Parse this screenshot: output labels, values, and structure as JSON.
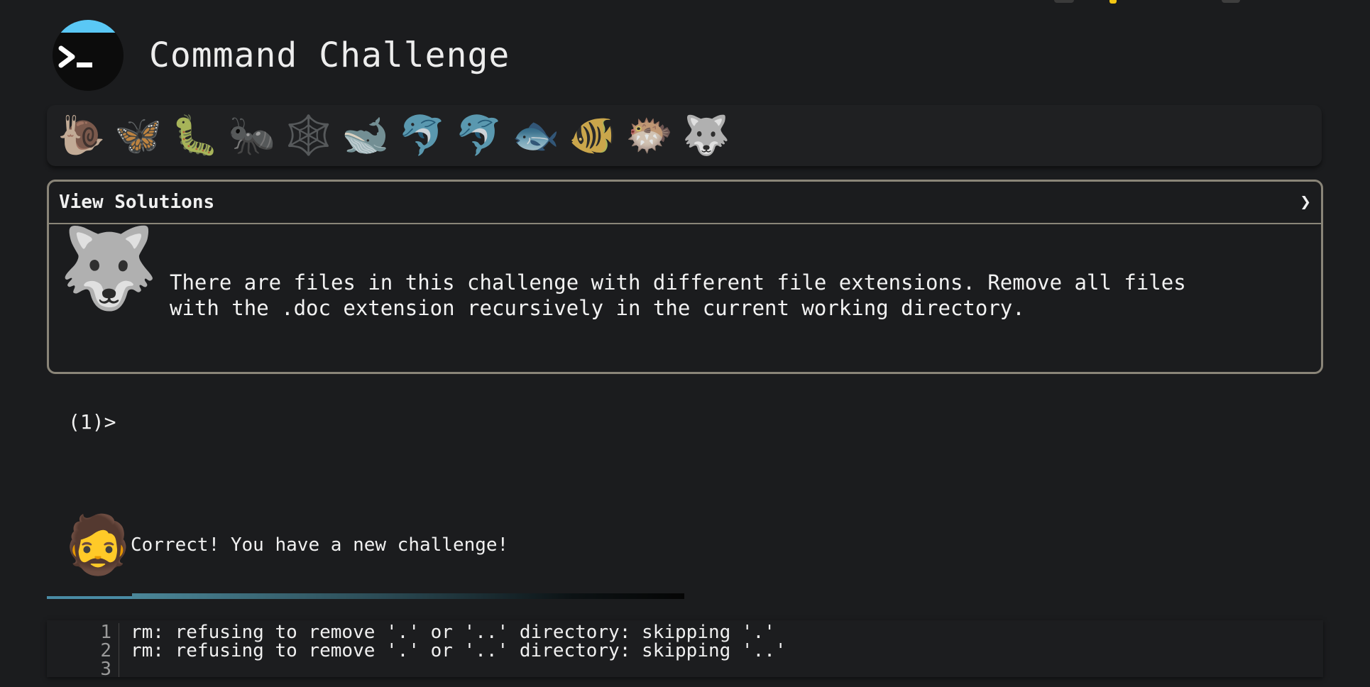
{
  "app": {
    "title": "Command Challenge"
  },
  "levels": [
    {
      "emoji": "🐌",
      "icon": "snail-icon"
    },
    {
      "emoji": "🦋",
      "icon": "butterfly-icon"
    },
    {
      "emoji": "🐛",
      "icon": "caterpillar-icon"
    },
    {
      "emoji": "🐜",
      "icon": "ant-icon"
    },
    {
      "emoji": "🕸️",
      "icon": "spider-web-icon"
    },
    {
      "emoji": "🐋",
      "icon": "whale-icon"
    },
    {
      "emoji": "🐬",
      "icon": "dolphin-icon"
    },
    {
      "emoji": "🐬",
      "icon": "dolphin-icon"
    },
    {
      "emoji": "🐟",
      "icon": "fish-icon"
    },
    {
      "emoji": "🐠",
      "icon": "tropical-fish-icon"
    },
    {
      "emoji": "🐡",
      "icon": "blowfish-icon"
    },
    {
      "emoji": "🐺",
      "icon": "wolf-icon",
      "current": true
    }
  ],
  "solutions": {
    "title": "View Solutions",
    "chevron": "❯",
    "challenge_icon": "🐺",
    "description": "There are files in this challenge with different file extensions. Remove all files\nwith the .doc extension recursively in the current working directory."
  },
  "prompt": {
    "label": "(1)>",
    "value": ""
  },
  "feedback": {
    "avatar": "🧔",
    "message": "Correct! You have a new challenge!",
    "progress": 0.81
  },
  "output": {
    "line_numbers": [
      "1",
      "2",
      "3"
    ],
    "lines": [
      "rm: refusing to remove '.' or '..' directory: skipping '.'",
      "rm: refusing to remove '.' or '..' directory: skipping '..'",
      ""
    ]
  },
  "colors": {
    "background": "#1b1c1e",
    "logo_cap": "#5ac8f5",
    "panel_border": "#8a8578",
    "progress": "#4b8799"
  }
}
